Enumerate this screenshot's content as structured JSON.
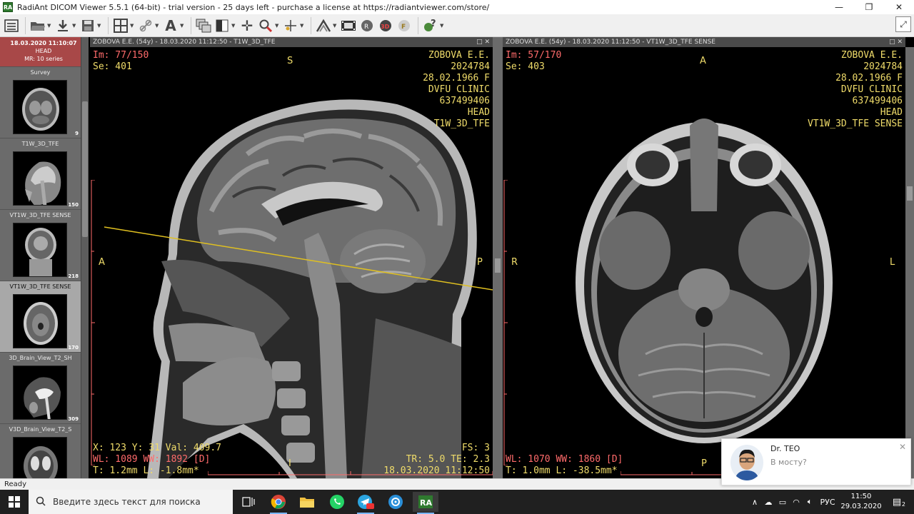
{
  "window": {
    "title": "RadiAnt DICOM Viewer 5.5.1 (64-bit) - trial version - 25 days left - purchase a license at https://radiantviewer.com/store/",
    "app_icon_text": "RA"
  },
  "study": {
    "date": "18.03.2020 11:10:07",
    "body_part": "HEAD",
    "modality_series": "MR: 10 series"
  },
  "series": [
    {
      "label": "Survey",
      "count": "9",
      "thumb": "coronal-brain"
    },
    {
      "label": "T1W_3D_TFE",
      "count": "150",
      "thumb": "sagittal-head"
    },
    {
      "label": "VT1W_3D_TFE SENSE",
      "count": "218",
      "thumb": "coronal-head"
    },
    {
      "label": "VT1W_3D_TFE SENSE",
      "count": "170",
      "thumb": "axial-brain",
      "active": true
    },
    {
      "label": "3D_Brain_View_T2_SH",
      "count": "309",
      "thumb": "sagittal-t2"
    },
    {
      "label": "V3D_Brain_View_T2_S",
      "count": "",
      "thumb": "coronal-t2"
    }
  ],
  "viewport_left": {
    "header": "ZOBOVA E.E. (54y) - 18.03.2020 11:12:50 - T1W_3D_TFE",
    "image": "Im: 77/150",
    "series": "Se: 401",
    "patient_name": "ZOBOVA E.E.",
    "patient_id": "2024784",
    "birth": "28.02.1966 F",
    "institution": "DVFU CLINIC",
    "accession": "637499406",
    "body_part": "HEAD",
    "protocol": "T1W_3D_TFE",
    "orient_top": "S",
    "orient_left": "A",
    "orient_right": "P",
    "orient_bottom": "I",
    "cursor": "X: 123 Y: 31 Val: 409.7",
    "window": "WL: 1089 WW: 1892 [D]",
    "thickness": "T: 1.2mm L: -1.8mm*",
    "fs": "FS: 3",
    "tr_te": "TR: 5.0 TE: 2.3",
    "datetime": "18.03.2020 11:12:50"
  },
  "viewport_right": {
    "header": "ZOBOVA E.E. (54y) - 18.03.2020 11:12:50 - VT1W_3D_TFE SENSE",
    "image": "Im: 57/170",
    "series": "Se: 403",
    "patient_name": "ZOBOVA E.E.",
    "patient_id": "2024784",
    "birth": "28.02.1966 F",
    "institution": "DVFU CLINIC",
    "accession": "637499406",
    "body_part": "HEAD",
    "protocol": "VT1W_3D_TFE SENSE",
    "orient_top": "A",
    "orient_left": "R",
    "orient_right": "L",
    "orient_bottom": "P",
    "window": "WL: 1070 WW: 1860 [D]",
    "thickness": "T: 1.0mm L: -38.5mm*"
  },
  "status": {
    "text": "Ready"
  },
  "notification": {
    "name": "Dr. TEO",
    "message": "В мосту?"
  },
  "taskbar": {
    "search_placeholder": "Введите здесь текст для поиска",
    "language": "РУС",
    "time": "11:50",
    "date": "29.03.2020",
    "notification_count": "2"
  },
  "colors": {
    "overlay_red": "#ff6b6b",
    "overlay_yellow": "#f0dc6a",
    "study_header": "#a84848"
  }
}
